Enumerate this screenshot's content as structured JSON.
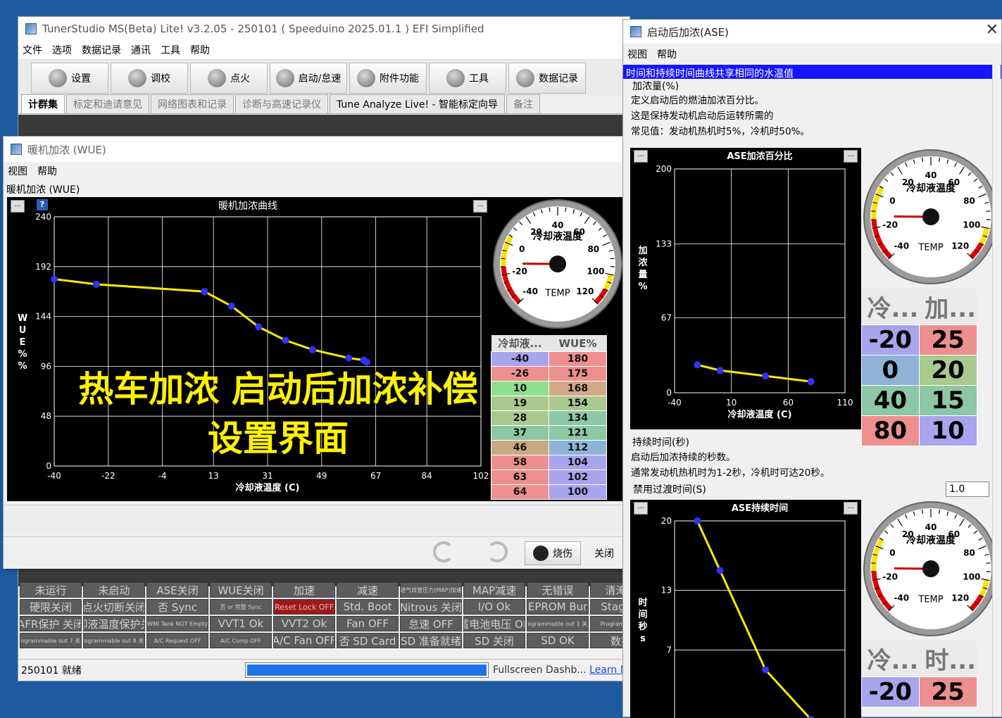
{
  "main": {
    "title": "TunerStudio MS(Beta) Lite! v3.2.05 - 250101 ( Speeduino 2025.01.1 ) EFI Simplified",
    "menu": [
      "文件",
      "选项",
      "数据记录",
      "通讯",
      "工具",
      "帮助"
    ],
    "toolbar": [
      "设置",
      "调校",
      "点火",
      "启动/怠速",
      "附件功能",
      "工具",
      "数据记录"
    ],
    "tabs": [
      "计群集",
      "标定和迪请意见",
      "网络图表和记录",
      "诊断与高速记录仪",
      "Tune Analyze Live! - 智能标定向导",
      "备注"
    ],
    "indicators": [
      "未运行",
      "未启动",
      "ASE关闭",
      "WUE关闭",
      "加速",
      "减速",
      "进气歧管压力(MAP)加速",
      "MAP减速",
      "无错误",
      "清淹量",
      "硬限关闭",
      "点火切断关闭",
      "否 Sync",
      "否 or 完整 Sync",
      "Reset Lock OFF",
      "Std. Boot",
      "Nitrous 关闭",
      "I/O Ok",
      "EEPROM Burn",
      "Staging",
      "AFR保护 关闭",
      "冷却液温度保护关闭",
      "WMI Tank NOT Empty",
      "VVT1 Ok",
      "VVT2 Ok",
      "Fan OFF",
      "怠速 OFF",
      "蓄电池电压 OK",
      "Programmable out 1 关闭",
      "Programmable",
      "Programmable out 7 关闭",
      "Programmable out 8 关闭",
      "A/C Request OFF",
      "A/C Comp OFF",
      "A/C Fan OFF",
      "否 SD Card",
      "SD 准备就绪",
      "SD 关闭",
      "SD OK",
      "数据"
    ],
    "status_text": "250101 就绪",
    "status_right": "Fullscreen Dashb...",
    "status_link": "Learn M"
  },
  "wue": {
    "title": "暖机加浓 (WUE)",
    "menu": [
      "视图",
      "帮助"
    ],
    "panel_label": "暖机加浓 (WUE)",
    "chart_title": "暖机加浓曲线",
    "overlay_line1": "热车加浓 启动后加浓补偿",
    "overlay_line2": "设置界面",
    "table_headers": [
      "冷却液...",
      "WUE%"
    ],
    "table_colors": [
      "#a9a4ee",
      "#ee8f8f",
      "#8de08d",
      "#a9c98f",
      "#a9c98f",
      "#8cc7a6",
      "#c9aa80",
      "#ee8f8f",
      "#ee8f8f",
      "#ee8f8f"
    ],
    "table_colors_r": [
      "#ee8f8f",
      "#ee8f8f",
      "#d2aa88",
      "#a9c98f",
      "#8cc7a6",
      "#8cc7a6",
      "#8fb3d8",
      "#a9a4ee",
      "#a9a4ee",
      "#a9a4ee"
    ],
    "burn_label": "烧伤",
    "close_label": "关闭"
  },
  "ase": {
    "title": "启动后加浓(ASE)",
    "menu": [
      "视图",
      "帮助"
    ],
    "selected_line": "时间和持续时间曲线共享相同的水温值",
    "section1": "加浓量(%)",
    "desc1": [
      "定义启动后的燃油加浓百分比。",
      "这是保持发动机启动后运转所需的",
      "常见值：发动机热机时5%，冷机时50%。"
    ],
    "section2": "持续时间(秒)",
    "desc2": [
      "启动后加浓持续的秒数。",
      "通常发动机热机时为1-2秒，冷机时可达20秒。"
    ],
    "input_label": "禁用过渡时间(S)",
    "input_value": "1.0",
    "pct_table_headers": [
      "冷...",
      "加..."
    ],
    "pct_colors_l": [
      "#a9a4ee",
      "#8fb3d8",
      "#8cc7a6",
      "#ee8f8f"
    ],
    "pct_colors_r": [
      "#ee8f8f",
      "#a9c98f",
      "#8cc7a6",
      "#a9a4ee"
    ],
    "dur_table_headers": [
      "冷...",
      "时..."
    ]
  },
  "gauge": {
    "title": "冷却液温度",
    "unit": "TEMP",
    "ticks": [
      "-40",
      "-20",
      "0",
      "20",
      "40",
      "60",
      "80",
      "100",
      "120"
    ],
    "min": -40,
    "max": 120,
    "value": -13
  },
  "chart_data": [
    {
      "type": "line",
      "title": "暖机加浓曲线",
      "xlabel": "冷却液温度 (C)",
      "ylabel": "W U E % %",
      "xlim": [
        -40,
        102
      ],
      "ylim": [
        0,
        240
      ],
      "xticks": [
        "-40",
        "-22",
        "-4",
        "13",
        "31",
        "49",
        "67",
        "84",
        "102"
      ],
      "yticks": [
        "240",
        "192",
        "144",
        "96",
        "48",
        "0"
      ],
      "x": [
        -40,
        -26,
        10,
        19,
        28,
        37,
        46,
        58,
        63,
        64
      ],
      "y": [
        180,
        175,
        168,
        154,
        134,
        121,
        112,
        104,
        102,
        100
      ]
    },
    {
      "type": "line",
      "title": "ASE加浓百分比",
      "xlabel": "冷却液温度 (C)",
      "ylabel": "加 浓 量 %",
      "xlim": [
        -40,
        110
      ],
      "ylim": [
        0,
        200
      ],
      "xticks": [
        "-40",
        "10",
        "60",
        "110"
      ],
      "yticks": [
        "200",
        "133",
        "67",
        "0"
      ],
      "x": [
        -20,
        0,
        40,
        80
      ],
      "y": [
        25,
        20,
        15,
        10
      ]
    },
    {
      "type": "line",
      "title": "ASE持续时间",
      "xlabel": "",
      "ylabel": "时 间 秒 s",
      "xlim": [
        -40,
        110
      ],
      "ylim": [
        0,
        20
      ],
      "yticks": [
        "20",
        "13",
        "7"
      ],
      "x": [
        -30,
        -20,
        0,
        40,
        80
      ],
      "y": [
        22,
        20,
        15,
        5,
        0
      ]
    }
  ]
}
